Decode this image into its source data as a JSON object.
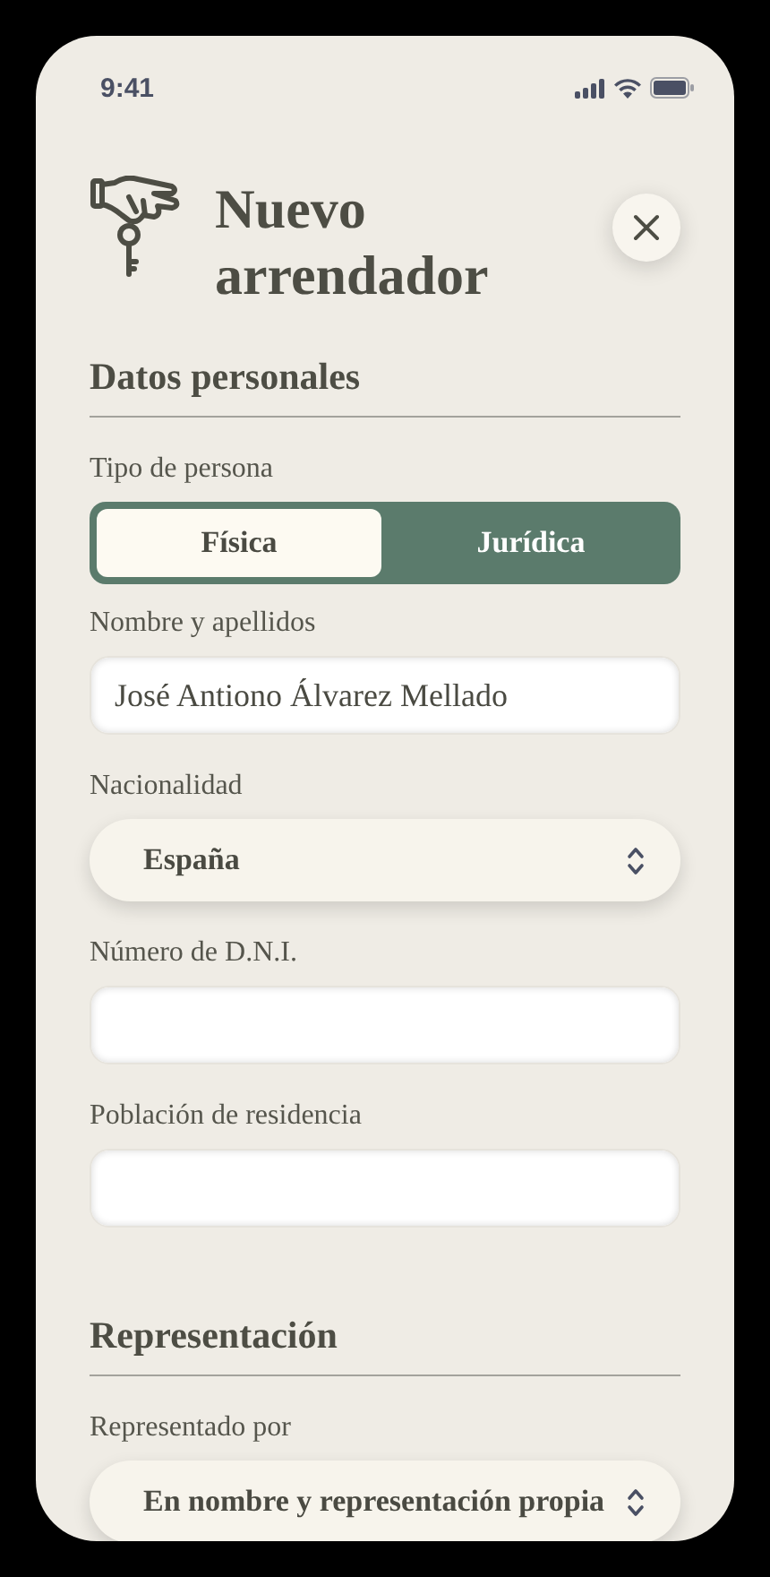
{
  "status_bar": {
    "time": "9:41"
  },
  "header": {
    "title": "Nuevo arrendador"
  },
  "sections": [
    {
      "title": "Datos personales",
      "fields": [
        {
          "kind": "segmented",
          "label": "Tipo de persona",
          "options": [
            {
              "label": "Física",
              "selected": true
            },
            {
              "label": "Jurídica",
              "selected": false
            }
          ]
        },
        {
          "kind": "text",
          "label": "Nombre y apellidos",
          "value": "José Antiono Álvarez Mellado"
        },
        {
          "kind": "select",
          "label": "Nacionalidad",
          "value": "España"
        },
        {
          "kind": "text",
          "label": "Número de D.N.I."
        },
        {
          "kind": "text",
          "label": "Población de residencia"
        }
      ]
    },
    {
      "title": "Representación",
      "fields": [
        {
          "kind": "select",
          "label": "Representado por",
          "value": "En nombre y representación propia"
        }
      ]
    }
  ]
}
